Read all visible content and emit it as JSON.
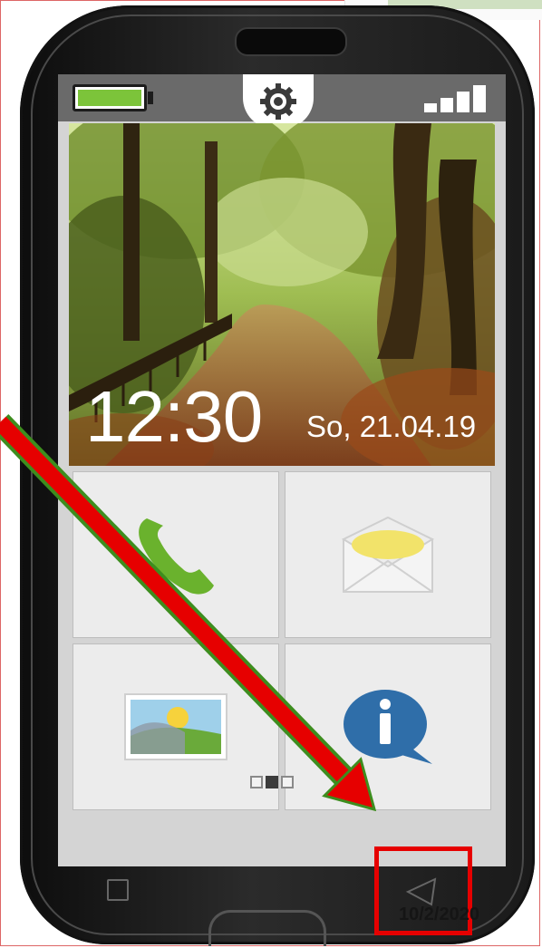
{
  "status_bar": {
    "battery_level": 1.0,
    "signal_bars": 4,
    "settings_icon": "gear-icon"
  },
  "lockscreen": {
    "time": "12:30",
    "date": "So, 21.04.19"
  },
  "tiles": [
    {
      "name": "phone",
      "icon": "phone-icon"
    },
    {
      "name": "messages",
      "icon": "envelope-icon"
    },
    {
      "name": "gallery",
      "icon": "picture-icon"
    },
    {
      "name": "info",
      "icon": "info-icon"
    }
  ],
  "pager": {
    "pages": 3,
    "active_page": 2
  },
  "annotation": {
    "date_stamp": "10/2/2020",
    "arrow_color": "#e60000",
    "arrow_outline": "#3d8d1e",
    "box_color": "#e60000"
  },
  "colors": {
    "battery": "#7cc43a",
    "phone_icon": "#6ab22d",
    "info_bubble": "#2f6ea9"
  }
}
